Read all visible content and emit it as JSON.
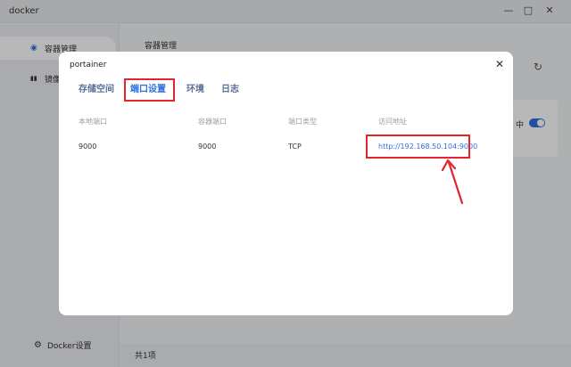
{
  "window": {
    "title": "docker",
    "minimize": "—",
    "maximize": "□",
    "close": "✕"
  },
  "sidebar": {
    "items": [
      {
        "label": "容器管理",
        "icon": "◉",
        "active": true
      },
      {
        "label": "镜像",
        "icon": "▮▮"
      }
    ],
    "bottom": {
      "label": "Docker设置",
      "icon": "⚙"
    }
  },
  "main": {
    "title": "容器管理",
    "refresh_icon": "↻",
    "status_text": "中",
    "footer_count": "共1项"
  },
  "modal": {
    "title": "portainer",
    "close_icon": "✕",
    "tabs": [
      "存储空间",
      "端口设置",
      "环境",
      "日志"
    ],
    "active_tab": 1,
    "table": {
      "headers": [
        "本地端口",
        "容器端口",
        "端口类型",
        "访问地址"
      ],
      "rows": [
        [
          "9000",
          "9000",
          "TCP",
          "http://192.168.50.104:9000"
        ]
      ]
    }
  },
  "colors": {
    "accent": "#2f6fdb",
    "highlight": "#e0262b"
  }
}
